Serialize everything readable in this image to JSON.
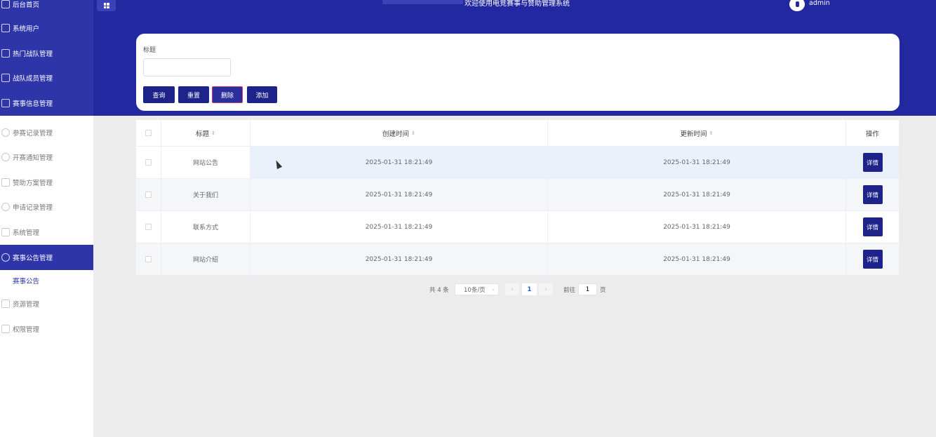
{
  "app": {
    "welcome": "欢迎使用电竞赛事与赞助管理系统",
    "username": "admin"
  },
  "sidebar": {
    "items": [
      {
        "label": "后台首页",
        "icon": "star-icon"
      },
      {
        "label": "系统用户",
        "icon": "grid-icon"
      },
      {
        "label": "热门战队管理",
        "icon": "clipboard-icon"
      },
      {
        "label": "战队成员管理",
        "icon": "doc-search-icon"
      },
      {
        "label": "赛事信息管理",
        "icon": "doc-icon"
      },
      {
        "label": "参赛记录管理",
        "icon": "user-icon"
      },
      {
        "label": "开赛通知管理",
        "icon": "chat-icon"
      },
      {
        "label": "赞助方案管理",
        "icon": "clipboard-icon"
      },
      {
        "label": "申请记录管理",
        "icon": "chat-icon"
      },
      {
        "label": "系统管理",
        "icon": "doc-search-icon"
      },
      {
        "label": "赛事公告管理",
        "icon": "chat-icon"
      },
      {
        "label": "资源管理",
        "icon": "doc-icon"
      },
      {
        "label": "权限管理",
        "icon": "clipboard-icon"
      }
    ],
    "submenu": {
      "label": "赛事公告"
    }
  },
  "search": {
    "title_label": "标题",
    "title_value": "",
    "buttons": {
      "query": "查询",
      "reset": "重置",
      "delete": "删除",
      "add": "添加"
    }
  },
  "table": {
    "columns": {
      "title": "标题",
      "created": "创建时间",
      "updated": "更新时间",
      "op": "操作"
    },
    "rows": [
      {
        "title": "网站公告",
        "created": "2025-01-31 18:21:49",
        "updated": "2025-01-31 18:21:49",
        "action": "详情"
      },
      {
        "title": "关于我们",
        "created": "2025-01-31 18:21:49",
        "updated": "2025-01-31 18:21:49",
        "action": "详情"
      },
      {
        "title": "联系方式",
        "created": "2025-01-31 18:21:49",
        "updated": "2025-01-31 18:21:49",
        "action": "详情"
      },
      {
        "title": "网站介绍",
        "created": "2025-01-31 18:21:49",
        "updated": "2025-01-31 18:21:49",
        "action": "详情"
      }
    ]
  },
  "pagination": {
    "total": "共 4 条",
    "page_size": "10条/页",
    "current": "1",
    "goto_label": "前往",
    "goto_value": "1",
    "page_suffix": "页"
  },
  "colors": {
    "primary": "#2228a0",
    "button": "#1e238a",
    "sidebar_active": "#2d35a8"
  }
}
